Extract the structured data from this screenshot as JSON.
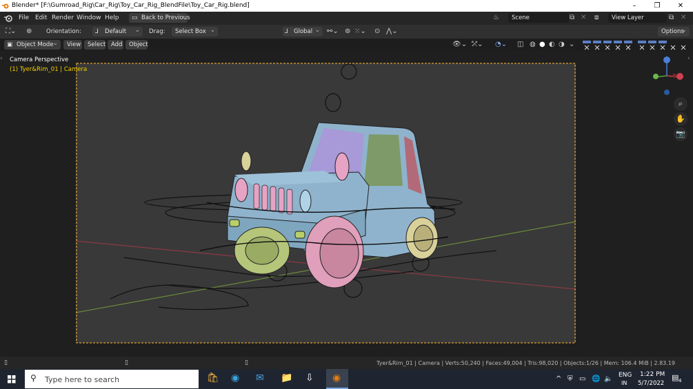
{
  "window": {
    "title": "Blender* [F:\\Gumroad_Rig\\Car_Rig\\Toy_Car_Rig_BlendFile\\Toy_Car_Rig.blend]",
    "minimize": "–",
    "maximize": "❐",
    "close": "✕"
  },
  "menu": {
    "items": [
      "File",
      "Edit",
      "Render",
      "Window",
      "Help"
    ],
    "back_button": "Back to Previous",
    "scene_label": "Scene",
    "view_layer_label": "View Layer"
  },
  "toolbar": {
    "orientation_label": "Orientation:",
    "orientation_value": "Default",
    "drag_label": "Drag:",
    "drag_value": "Select Box",
    "transform_orientation": "Global",
    "options_label": "Options"
  },
  "view_header": {
    "mode": "Object Mode",
    "view": "View",
    "select": "Select",
    "add": "Add",
    "object": "Object"
  },
  "viewport": {
    "camera_label": "Camera Perspective",
    "active_object": "(1) Tyer&Rim_01 | Camera",
    "active_object_color": "#f5d000",
    "camera_frame_color": "#e0a030",
    "background": "#3a3a3a"
  },
  "status": {
    "stats": "Tyer&Rim_01 | Camera | Verts:50,240 | Faces:49,004 | Tris:98,020 | Objects:1/26 | Mem: 106.4 MiB | 2.83.19"
  },
  "taskbar": {
    "search_placeholder": "Type here to search",
    "lang_top": "ENG",
    "lang_bottom": "IN",
    "time": "1:22 PM",
    "date": "5/7/2022",
    "notification_count": "4"
  }
}
